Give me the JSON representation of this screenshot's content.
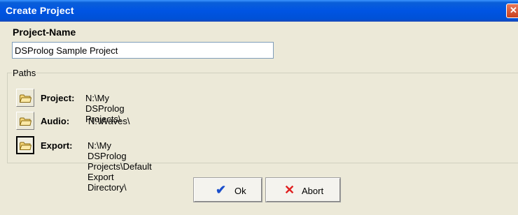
{
  "window": {
    "title": "Create Project",
    "close_glyph": "✕"
  },
  "project_name": {
    "label": "Project-Name",
    "value": "DSProlog Sample Project"
  },
  "paths": {
    "legend": "Paths",
    "project": {
      "label": "Project:",
      "value": "N:\\My DSProlog Projects\\"
    },
    "audio": {
      "label": "Audio:",
      "value": "N:\\Waves\\"
    },
    "export": {
      "label": "Export:",
      "value": "N:\\My DSProlog Projects\\Default Export Directory\\"
    }
  },
  "buttons": {
    "ok": {
      "label": "Ok",
      "icon": "check-icon",
      "glyph": "✔",
      "color": "#1a4ecc"
    },
    "abort": {
      "label": "Abort",
      "icon": "x-icon",
      "glyph": "✕",
      "color": "#e02020"
    }
  }
}
